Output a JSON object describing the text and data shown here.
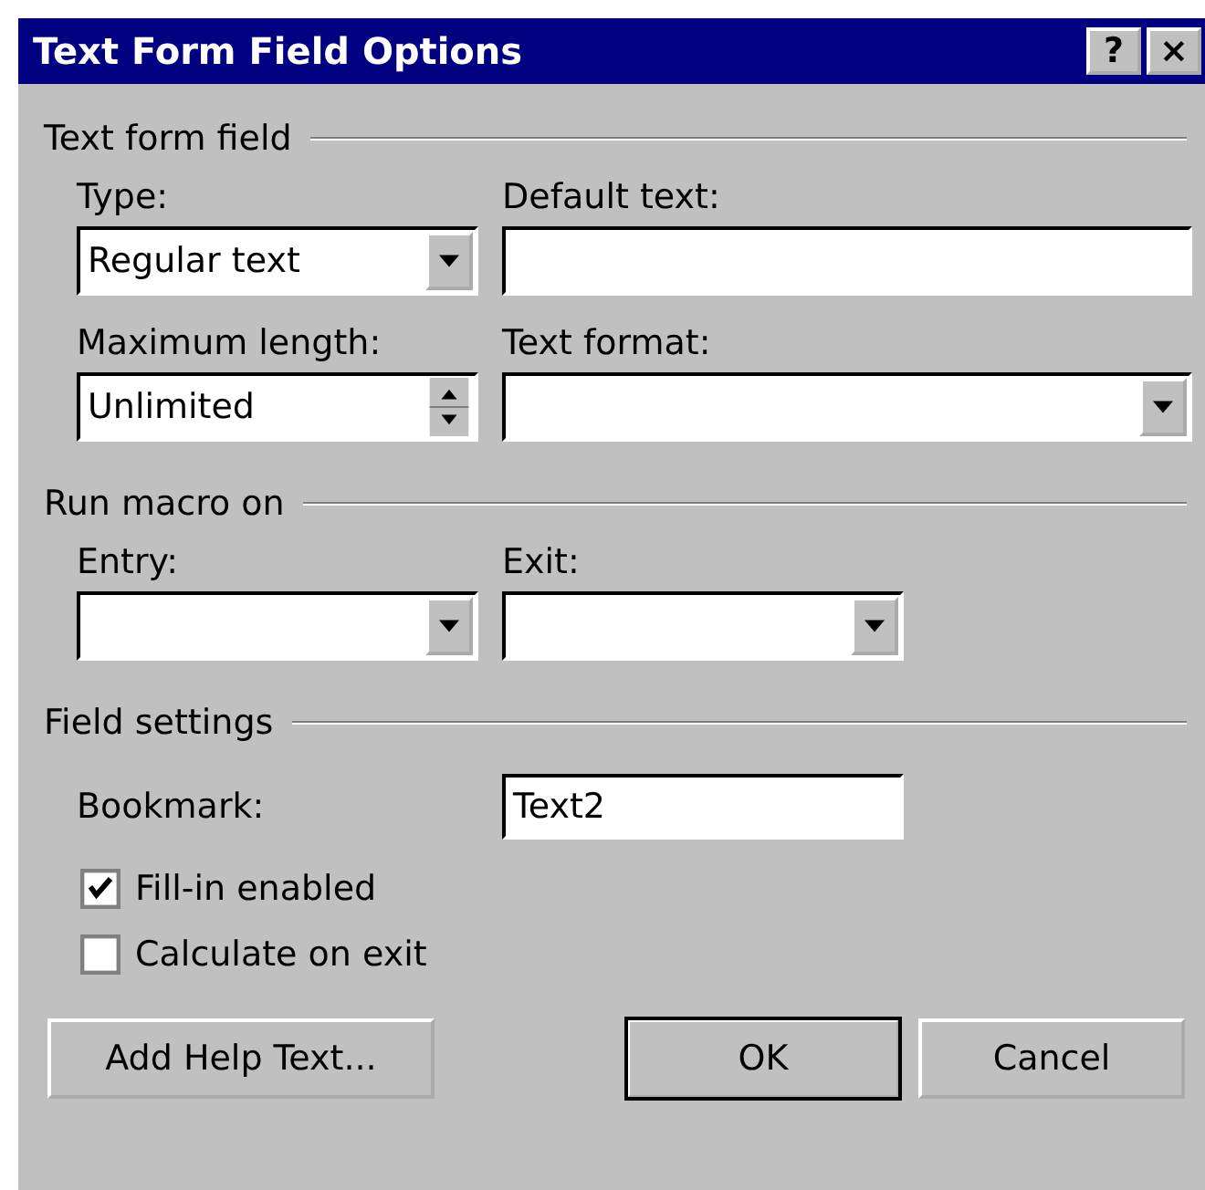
{
  "window": {
    "title": "Text Form Field Options",
    "title_buttons": [
      "?",
      "×"
    ]
  },
  "sections": [
    {
      "title": "Text form field",
      "rows": [
        {
          "fields": [
            {
              "label": "Type:",
              "kind": "combo",
              "value": "Regular text"
            },
            {
              "label": "Default text:",
              "kind": "text"
            }
          ]
        },
        {
          "fields": [
            {
              "label": "Maximum length:",
              "kind": "spin",
              "value": "Unlimited"
            },
            {
              "label": "Text format:",
              "kind": "combo"
            }
          ]
        }
      ]
    },
    {
      "title": "Run macro on",
      "rows": [
        {
          "fields": [
            {
              "label": "Entry:",
              "kind": "combo"
            },
            {
              "label": "Exit:",
              "kind": "combo-short"
            }
          ]
        }
      ]
    },
    {
      "title": "Field settings"
    }
  ],
  "bookmark": {
    "label": "Bookmark:",
    "value": "Text2"
  },
  "checkboxes": [
    {
      "label": "Fill-in enabled",
      "checked": true
    },
    {
      "label": "Calculate on exit",
      "checked": false
    }
  ],
  "buttons": [
    {
      "label": "Add Help Text...",
      "default": false
    },
    {
      "label": "OK",
      "default": true
    },
    {
      "label": "Cancel",
      "default": false
    }
  ]
}
